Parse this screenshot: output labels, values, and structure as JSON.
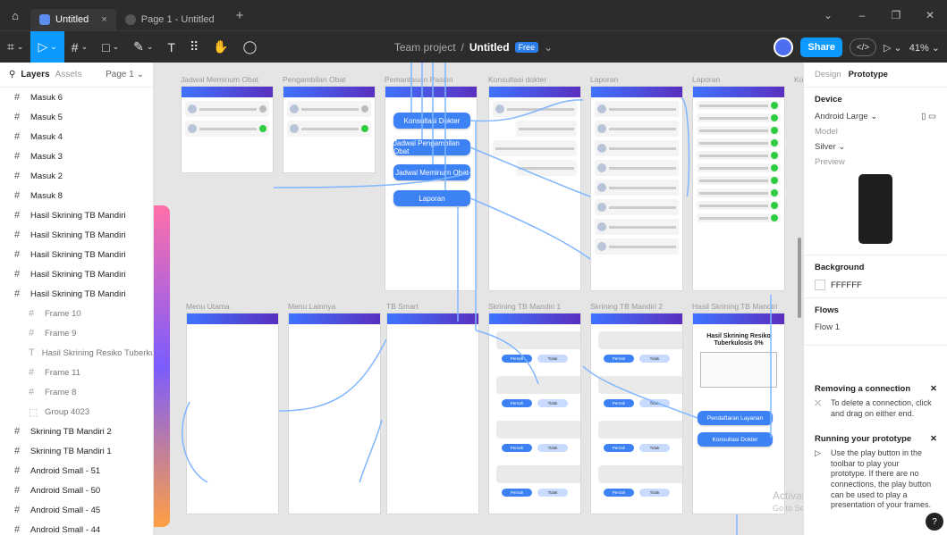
{
  "titlebar": {
    "tabs": [
      {
        "label": "Untitled",
        "close": "×"
      },
      {
        "label": "Page 1 - Untitled"
      }
    ],
    "plus": "+",
    "window_controls": [
      "⌄",
      "–",
      "❐",
      "✕"
    ]
  },
  "toolbar": {
    "tools": [
      "⌗",
      "▷",
      "#",
      "□",
      "✎",
      "T",
      "⠿",
      "✋",
      "◯"
    ],
    "team": "Team project",
    "separator": "/",
    "file_name": "Untitled",
    "plan_badge": "Free",
    "share_label": "Share",
    "code_label": "</>",
    "play_label": "▷ ⌄",
    "zoom": "41% ⌄"
  },
  "left_panel": {
    "tab_layers": "Layers",
    "tab_assets": "Assets",
    "page_selector": "Page 1 ⌄",
    "layers": [
      {
        "name": "Masuk 6",
        "kind": "frame",
        "sub": false
      },
      {
        "name": "Masuk 5",
        "kind": "frame",
        "sub": false
      },
      {
        "name": "Masuk 4",
        "kind": "frame",
        "sub": false
      },
      {
        "name": "Masuk 3",
        "kind": "frame",
        "sub": false
      },
      {
        "name": "Masuk 2",
        "kind": "frame",
        "sub": false
      },
      {
        "name": "Masuk 8",
        "kind": "frame",
        "sub": false
      },
      {
        "name": "Hasil Skrining TB Mandiri",
        "kind": "frame",
        "sub": false
      },
      {
        "name": "Hasil Skrining TB Mandiri",
        "kind": "frame",
        "sub": false
      },
      {
        "name": "Hasil Skrining TB Mandiri",
        "kind": "frame",
        "sub": false
      },
      {
        "name": "Hasil Skrining TB Mandiri",
        "kind": "frame",
        "sub": false
      },
      {
        "name": "Hasil Skrining TB Mandiri",
        "kind": "frame",
        "sub": false
      },
      {
        "name": "Frame 10",
        "kind": "frame",
        "sub": true
      },
      {
        "name": "Frame 9",
        "kind": "frame",
        "sub": true
      },
      {
        "name": "Hasil Skrining Resiko Tuberkul...",
        "kind": "text",
        "sub": true
      },
      {
        "name": "Frame 11",
        "kind": "frame",
        "sub": true
      },
      {
        "name": "Frame 8",
        "kind": "frame",
        "sub": true
      },
      {
        "name": "Group 4023",
        "kind": "group",
        "sub": true
      },
      {
        "name": "Skrining TB Mandiri 2",
        "kind": "frame",
        "sub": false
      },
      {
        "name": "Skrining TB Mandiri 1",
        "kind": "frame",
        "sub": false
      },
      {
        "name": "Android Small - 51",
        "kind": "frame",
        "sub": false
      },
      {
        "name": "Android Small - 50",
        "kind": "frame",
        "sub": false
      },
      {
        "name": "Android Small - 45",
        "kind": "frame",
        "sub": false
      },
      {
        "name": "Android Small - 44",
        "kind": "frame",
        "sub": false
      }
    ]
  },
  "canvas": {
    "frame_labels_top": [
      "Jadwal Meminum Obat",
      "Pengambilan Obat",
      "Pemantauan Pasien",
      "Konsultasi dokter",
      "Laporan",
      "Laporan",
      "Ko"
    ],
    "frame_labels_bottom": [
      "Menu Utama",
      "Menu Lainnya",
      "TB Smart",
      "Skrining TB Mandiri 1",
      "Skrining TB Mandiri 2",
      "Hasil Skrining TB Mandiri"
    ],
    "buttons": [
      "Konsultasi Dokter",
      "Jadwal Pengambilan Obat",
      "Jadwal Meminum Obat",
      "Laporan"
    ],
    "result_title": "Hasil Skrining Resiko Tuberkulosis 0%",
    "result_buttons": [
      "Pendaftaran Layanan",
      "Konsultasi Dokter"
    ],
    "yes_label": "Pernah",
    "no_label": "Tidak",
    "watermark_title": "Activate Windows",
    "watermark_sub": "Go to Settings to activate Windows."
  },
  "right_panel": {
    "tab_design": "Design",
    "tab_prototype": "Prototype",
    "device_title": "Device",
    "device_value": "Android Large ⌄",
    "model_label": "Model",
    "model_value": "Silver ⌄",
    "preview_label": "Preview",
    "background_title": "Background",
    "background_value": "FFFFFF",
    "flows_title": "Flows",
    "flow_item": "Flow 1",
    "notice1_title": "Removing a connection",
    "notice1_body": "To delete a connection, click and drag on either end.",
    "notice2_title": "Running your prototype",
    "notice2_body": "Use the play button in the toolbar to play your prototype. If there are no connections, the play button can be used to play a presentation of your frames.",
    "help": "?"
  }
}
